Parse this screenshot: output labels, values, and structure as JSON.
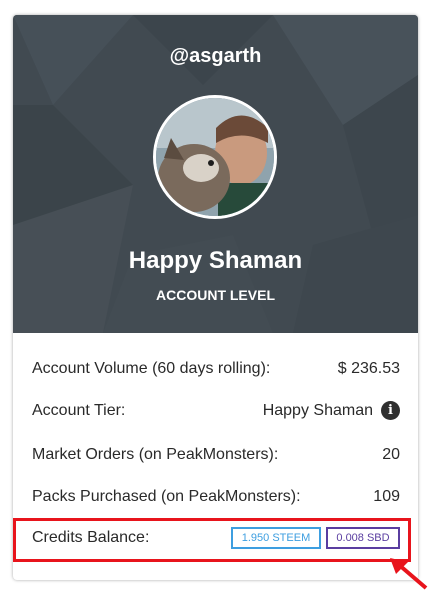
{
  "profile": {
    "username": "@asgarth",
    "account_name": "Happy Shaman",
    "account_level_label": "ACCOUNT LEVEL"
  },
  "stats": {
    "volume_label": "Account Volume (60 days rolling):",
    "volume_value": "$ 236.53",
    "tier_label": "Account Tier:",
    "tier_value": "Happy Shaman",
    "market_orders_label": "Market Orders (on PeakMonsters):",
    "market_orders_value": "20",
    "packs_label": "Packs Purchased (on PeakMonsters):",
    "packs_value": "109",
    "credits_label": "Credits Balance:",
    "steem_balance": "1.950 STEEM",
    "sbd_balance": "0.008 SBD"
  },
  "icons": {
    "info": "info-icon",
    "arrow": "arrow-pointer-icon"
  },
  "colors": {
    "header_bg": "#414a51",
    "steem_accent": "#3d9ee0",
    "sbd_accent": "#5a3da0",
    "highlight": "#e8141c"
  }
}
